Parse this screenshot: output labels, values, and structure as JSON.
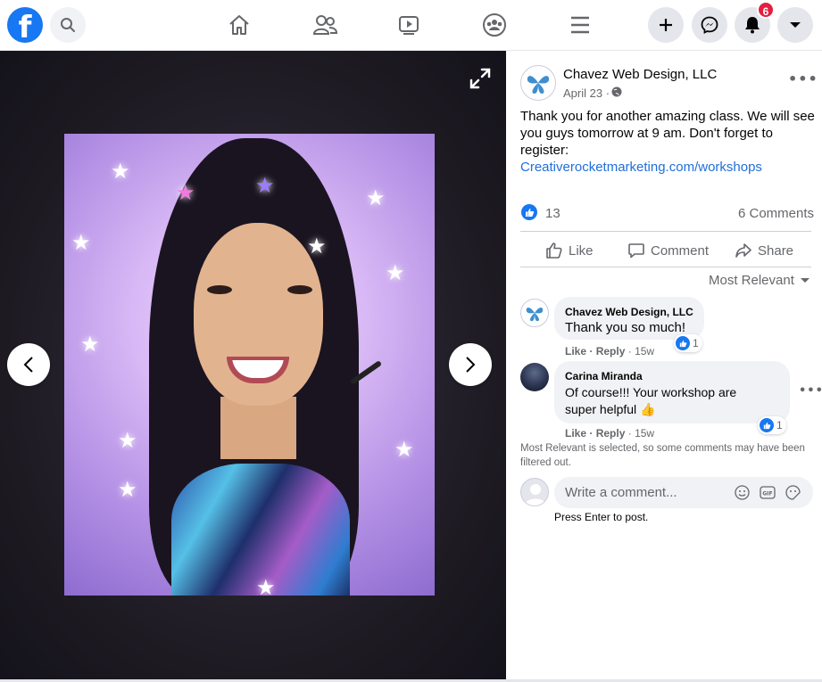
{
  "topbar": {
    "logo": "f",
    "notification_count": "6",
    "nav_icons": [
      "home-icon",
      "friends-icon",
      "watch-icon",
      "groups-icon",
      "menu-icon"
    ],
    "right_icons": [
      "create-icon",
      "messenger-icon",
      "notifications-icon",
      "account-dropdown-icon"
    ]
  },
  "post": {
    "page_name": "Chavez Web Design, LLC",
    "date": "April 23 ·",
    "text_line1": "Thank you for another amazing class. We will see",
    "text_line2": "you guys tomorrow at 9 am. Don't forget to",
    "text_line3": "register:",
    "link": "Creativerocketmarketing.com/workshops",
    "like_count": "13",
    "comment_count": "6 Comments",
    "actions": {
      "like": "Like",
      "comment": "Comment",
      "share": "Share"
    },
    "sort_label": "Most Relevant"
  },
  "comments": [
    {
      "author": "Chavez Web Design, LLC",
      "text": "Thank you so much!",
      "like": "Like",
      "reply": "Reply",
      "time": "· 15w",
      "reactions": "1"
    },
    {
      "author": "Carina Miranda",
      "text_line1": "Of course!!! Your workshop are",
      "text_line2": "super helpful 👍",
      "like": "Like",
      "reply": "Reply",
      "time": "· 15w",
      "reactions": "1"
    }
  ],
  "filter_note_line1": "Most Relevant is selected, so some comments may have been",
  "filter_note_line2": "filtered out.",
  "composer": {
    "placeholder": "Write a comment...",
    "hint": "Press Enter to post."
  },
  "colors": {
    "brand": "#1877f2",
    "link": "#216fdb",
    "badge": "#e41e3f"
  }
}
